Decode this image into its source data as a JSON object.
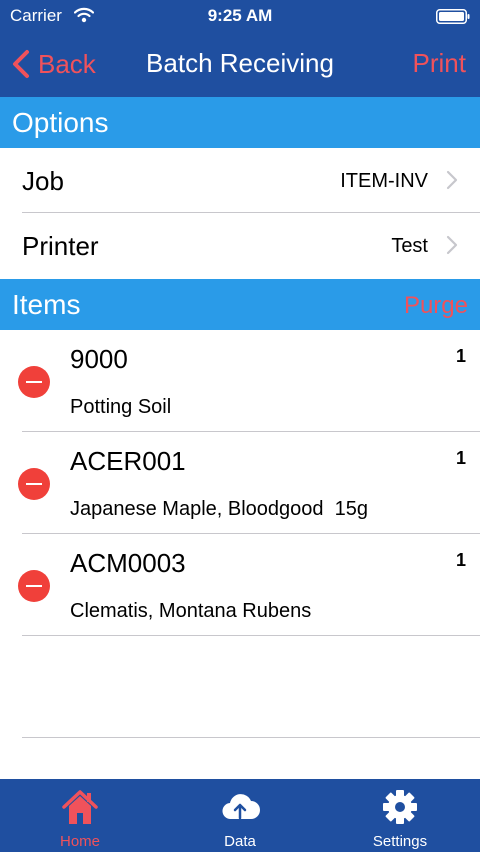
{
  "status_bar": {
    "carrier": "Carrier",
    "time": "9:25 AM"
  },
  "nav": {
    "back_label": "Back",
    "title": "Batch Receiving",
    "print_label": "Print"
  },
  "options": {
    "header": "Options",
    "rows": [
      {
        "label": "Job",
        "value": "ITEM-INV"
      },
      {
        "label": "Printer",
        "value": "Test"
      }
    ]
  },
  "items": {
    "header": "Items",
    "purge_label": "Purge",
    "rows": [
      {
        "code": "9000",
        "qty": "1",
        "description": "Potting Soil"
      },
      {
        "code": "ACER001",
        "qty": "1",
        "description": "Japanese Maple, Bloodgood  15g"
      },
      {
        "code": "ACM0003",
        "qty": "1",
        "description": "Clematis, Montana Rubens"
      }
    ]
  },
  "tab_bar": {
    "tabs": [
      {
        "label": "Home",
        "icon": "home-icon",
        "active": true
      },
      {
        "label": "Data",
        "icon": "cloud-upload-icon",
        "active": false
      },
      {
        "label": "Settings",
        "icon": "gear-icon",
        "active": false
      }
    ]
  },
  "colors": {
    "nav_background": "#1f4fa0",
    "section_header": "#2a9be8",
    "accent_red": "#f0525b",
    "delete_red": "#f0403a"
  }
}
